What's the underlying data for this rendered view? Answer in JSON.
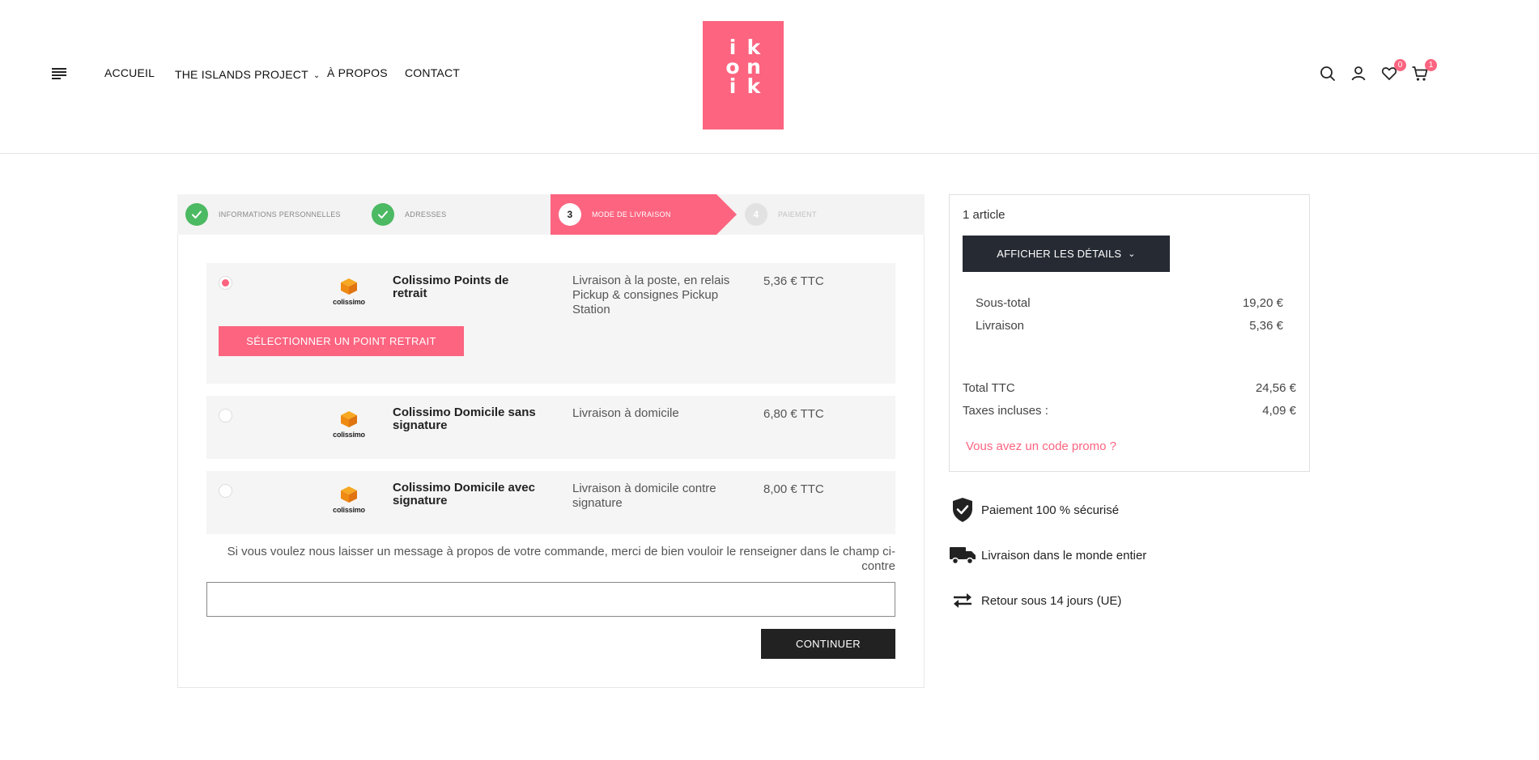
{
  "header": {
    "nav": [
      {
        "label": "ACCUEIL"
      },
      {
        "label": "THE ISLANDS PROJECT"
      },
      {
        "label": "À PROPOS"
      },
      {
        "label": "CONTACT"
      }
    ],
    "logo": {
      "letters": [
        "i",
        "k",
        "o",
        "n",
        "i",
        "k"
      ],
      "color": "#fc6480"
    },
    "wishlist_count": "0",
    "cart_count": "1"
  },
  "steps": [
    {
      "number": "",
      "label": "INFORMATIONS PERSONNELLES",
      "state": "done"
    },
    {
      "number": "",
      "label": "ADRESSES",
      "state": "done"
    },
    {
      "number": "3",
      "label": "MODE DE LIVRAISON",
      "state": "active"
    },
    {
      "number": "4",
      "label": "PAIEMENT",
      "state": "future"
    }
  ],
  "delivery_options": [
    {
      "name": "Colissimo Points de retrait",
      "description": "Livraison à la poste, en relais Pickup & consignes Pickup Station",
      "price": "5,36 € TTC",
      "selected": true,
      "carrier_logo_text": "colissimo"
    },
    {
      "name": "Colissimo Domicile sans signature",
      "description": "Livraison à domicile",
      "price": "6,80 € TTC",
      "selected": false,
      "carrier_logo_text": "colissimo"
    },
    {
      "name": "Colissimo Domicile avec signature",
      "description": "Livraison à domicile contre signature",
      "price": "8,00 € TTC",
      "selected": false,
      "carrier_logo_text": "colissimo"
    }
  ],
  "select_point_label": "SÉLECTIONNER UN POINT RETRAIT",
  "message_label": "Si vous voulez nous laisser un message à propos de votre commande, merci de bien vouloir le renseigner dans le champ ci-contre",
  "message_value": "",
  "continue_label": "CONTINUER",
  "summary": {
    "count": "1 article",
    "details_label": "AFFICHER LES DÉTAILS",
    "subtotal_label": "Sous-total",
    "subtotal_value": "19,20 €",
    "shipping_label": "Livraison",
    "shipping_value": "5,36 €",
    "total_label": "Total TTC",
    "total_value": "24,56 €",
    "tax_label": "Taxes incluses :",
    "tax_value": "4,09 €",
    "promo_label": "Vous avez un code promo ?"
  },
  "reassurance": [
    {
      "text": "Paiement 100 % sécurisé",
      "icon": "shield-check-icon"
    },
    {
      "text": "Livraison dans le monde entier",
      "icon": "truck-icon"
    },
    {
      "text": "Retour sous 14 jours (UE)",
      "icon": "exchange-arrows-icon"
    }
  ],
  "colors": {
    "accent": "#fc6480",
    "success": "#4cb963",
    "dark": "#222222"
  }
}
